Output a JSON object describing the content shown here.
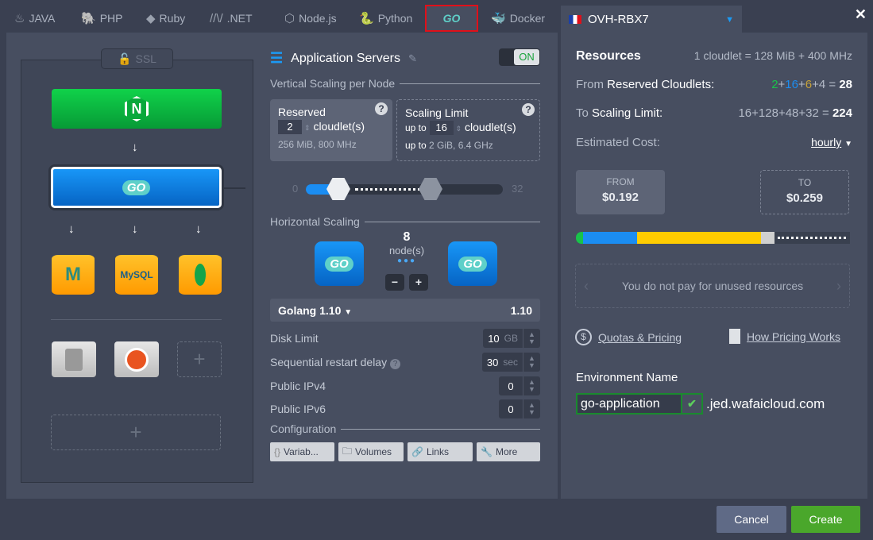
{
  "tabs": [
    {
      "label": "JAVA",
      "icon": "java-icon"
    },
    {
      "label": "PHP",
      "icon": "php-icon"
    },
    {
      "label": "Ruby",
      "icon": "ruby-icon"
    },
    {
      "label": ".NET",
      "icon": "dotnet-icon"
    },
    {
      "label": "Node.js",
      "icon": "nodejs-icon"
    },
    {
      "label": "Python",
      "icon": "python-icon"
    },
    {
      "label": "GO",
      "icon": "go-icon",
      "active": true
    },
    {
      "label": "Docker",
      "icon": "docker-icon"
    }
  ],
  "region": {
    "label": "OVH-RBX7"
  },
  "topology": {
    "ssl": "SSL",
    "nginx": "N",
    "go": "GO",
    "databases": [
      "M",
      "MySQL",
      "mongo"
    ]
  },
  "app": {
    "title": "Application Servers",
    "toggle": "ON",
    "vertical": {
      "title": "Vertical Scaling per Node",
      "reserved_label": "Reserved",
      "reserved_value": "2",
      "unit": "cloudlet(s)",
      "reserved_info": "256 MiB, 800 MHz",
      "limit_label": "Scaling Limit",
      "up_to": "up to",
      "limit_value": "16",
      "limit_info_prefix": "up to",
      "limit_info": "2 GiB, 6.4 GHz",
      "slider_min": "0",
      "slider_max": "32",
      "reserved_cloudlets": 2,
      "limit_cloudlets": 16
    },
    "horizontal": {
      "title": "Horizontal Scaling",
      "nodes": "8",
      "nodes_label": "node(s)",
      "minus": "−",
      "plus": "+"
    },
    "version": {
      "selected": "Golang 1.10",
      "value": "1.10"
    },
    "disk": {
      "label": "Disk Limit",
      "value": "10",
      "unit": "GB"
    },
    "restart": {
      "label": "Sequential restart delay",
      "value": "30",
      "unit": "sec"
    },
    "ipv4": {
      "label": "Public IPv4",
      "value": "0"
    },
    "ipv6": {
      "label": "Public IPv6",
      "value": "0"
    },
    "config": {
      "title": "Configuration",
      "buttons": [
        "Variab...",
        "Volumes",
        "Links",
        "More"
      ]
    }
  },
  "resources": {
    "title": "Resources",
    "cloudlet_def": "1 cloudlet = 128 MiB + 400 MHz",
    "from_label_a": "From",
    "from_label_b": "Reserved Cloudlets:",
    "from_parts": [
      "2",
      "16",
      "6",
      "4"
    ],
    "from_total": "28",
    "to_label_a": "To",
    "to_label_b": "Scaling Limit:",
    "to_parts": [
      "16",
      "128",
      "48",
      "32"
    ],
    "to_total": "224",
    "cost_label": "Estimated Cost:",
    "period": "hourly",
    "from_price_label": "FROM",
    "from_price": "$0.192",
    "to_price_label": "TO",
    "to_price": "$0.259",
    "notice": "You do not pay for unused resources",
    "quotas": "Quotas & Pricing",
    "how": "How Pricing Works",
    "env_label": "Environment Name",
    "env_value": "go-application",
    "domain": ".jed.wafaicloud.com",
    "colors": {
      "green": "#19c24a",
      "blue": "#1b8df2",
      "yellow": "#ffcc00",
      "gray": "#d0d0d0"
    }
  },
  "footer": {
    "cancel": "Cancel",
    "create": "Create"
  }
}
